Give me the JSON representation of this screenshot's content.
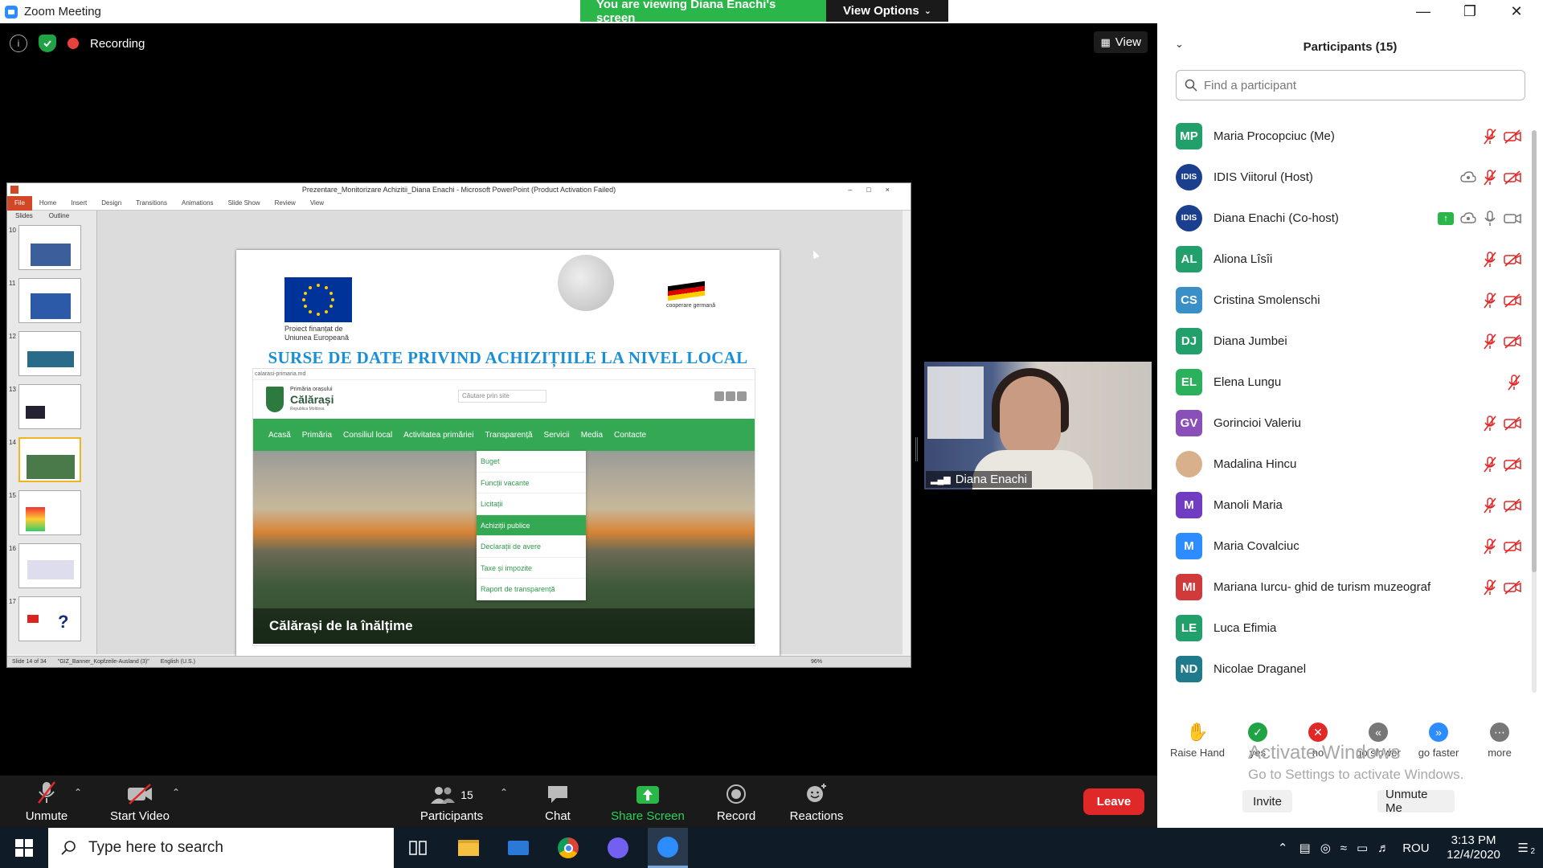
{
  "window": {
    "title": "Zoom Meeting"
  },
  "share_banner": {
    "text": "You are viewing Diana Enachi's screen",
    "view_options": "View Options"
  },
  "meeting_top": {
    "recording_label": "Recording",
    "view_label": "View"
  },
  "ppt": {
    "title": "Prezentare_Monitorizare Achizitii_Diana Enachi - Microsoft PowerPoint (Product Activation Failed)",
    "file_tab": "File",
    "ribbon_tabs": [
      "Home",
      "Insert",
      "Design",
      "Transitions",
      "Animations",
      "Slide Show",
      "Review",
      "View"
    ],
    "side_tabs": [
      "Slides",
      "Outline"
    ],
    "slide_numbers": [
      "10",
      "11",
      "12",
      "13",
      "14",
      "15",
      "16",
      "17"
    ],
    "selected_slide": "14",
    "status": [
      "Slide 14 of 34",
      "\"GIZ_Banner_Kopfzeile-Ausland (3)\"",
      "English (U.S.)"
    ],
    "zoom": "96%"
  },
  "slide": {
    "eu_caption": "Proiect finanțat de Uniunea Europeană",
    "giz_caption": "cooperare germană",
    "heading": "SURSE DE DATE PRIVIND ACHIZIȚIILE LA NIVEL LOCAL",
    "url": "calarasi-primaria.md",
    "site_title_top": "Primăria orașului",
    "site_title": "Călărași",
    "site_subtitle": "Republica Moldova",
    "search_placeholder": "Căutare prin site",
    "nav": [
      "Acasă",
      "Primăria",
      "Consiliul local",
      "Activitatea primăriei",
      "Transparență",
      "Servicii",
      "Media",
      "Contacte"
    ],
    "dropdown": [
      "Buget",
      "Funcții vacante",
      "Licitații",
      "Achiziții publice",
      "Declarații de avere",
      "Taxe și impozite",
      "Raport de transparență"
    ],
    "dropdown_active": "Achiziții publice",
    "hero_caption": "Călărași de la înălțime"
  },
  "video": {
    "name": "Diana Enachi"
  },
  "toolbar": {
    "unmute": "Unmute",
    "start_video": "Start Video",
    "participants": "Participants",
    "participants_count": "15",
    "chat": "Chat",
    "share_screen": "Share Screen",
    "record": "Record",
    "reactions": "Reactions",
    "leave": "Leave"
  },
  "participants": {
    "title": "Participants (15)",
    "search_placeholder": "Find a participant",
    "list": [
      {
        "initials": "MP",
        "name": "Maria Procopciuc (Me)",
        "color": "#22a06b"
      },
      {
        "initials": "IDIS",
        "name": "IDIS Viitorul (Host)",
        "color": "#1b3f8f"
      },
      {
        "initials": "IDIS",
        "name": "Diana Enachi (Co-host)",
        "color": "#1b3f8f"
      },
      {
        "initials": "AL",
        "name": "Aliona Lîsîi",
        "color": "#22a06b"
      },
      {
        "initials": "CS",
        "name": "Cristina Smolenschi",
        "color": "#3a8fc7"
      },
      {
        "initials": "DJ",
        "name": "Diana Jumbei",
        "color": "#22a06b"
      },
      {
        "initials": "EL",
        "name": "Elena Lungu",
        "color": "#2bb05c"
      },
      {
        "initials": "GV",
        "name": "Gorincioi Valeriu",
        "color": "#8a4fb8"
      },
      {
        "initials": "",
        "name": "Madalina Hincu",
        "color": "#d9b08c"
      },
      {
        "initials": "M",
        "name": "Manoli Maria",
        "color": "#6f3cc2"
      },
      {
        "initials": "M",
        "name": "Maria Covalciuc",
        "color": "#2d8cff"
      },
      {
        "initials": "MI",
        "name": "Mariana Iurcu- ghid de turism muzeograf",
        "color": "#d03a3a"
      },
      {
        "initials": "LE",
        "name": "Luca Efimia",
        "color": "#22a06b"
      },
      {
        "initials": "ND",
        "name": "Nicolae Draganel",
        "color": "#1f7a8c"
      }
    ],
    "reactions": [
      "Raise Hand",
      "yes",
      "no",
      "go slower",
      "go faster",
      "more"
    ],
    "invite": "Invite",
    "unmute_me": "Unmute Me"
  },
  "watermark": {
    "line1": "Activate Windows",
    "line2": "Go to Settings to activate Windows."
  },
  "taskbar": {
    "search_placeholder": "Type here to search",
    "language": "ROU",
    "time": "3:13 PM",
    "date": "12/4/2020",
    "notifications": "2"
  }
}
